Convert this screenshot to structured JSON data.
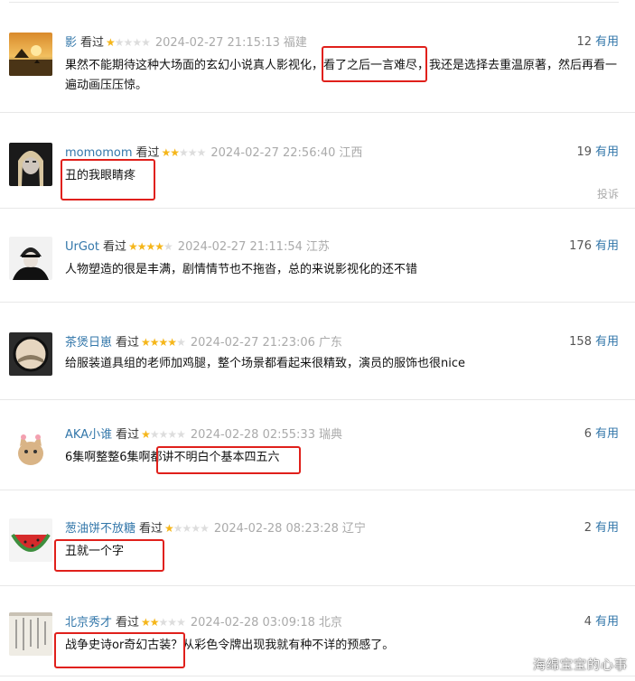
{
  "reviews": [
    {
      "user": "影",
      "status": "看过",
      "rating": 1,
      "time": "2024-02-27 21:15:13",
      "location": "福建",
      "votes": "12",
      "useful": "有用",
      "text": "果然不能期待这种大场面的玄幻小说真人影视化，看了之后一言难尽，我还是选择去重温原著，然后再看一遍动画压压惊。"
    },
    {
      "user": "momomom",
      "status": "看过",
      "rating": 2,
      "time": "2024-02-27 22:56:40",
      "location": "江西",
      "votes": "19",
      "useful": "有用",
      "text": "丑的我眼睛疼",
      "report": "投诉"
    },
    {
      "user": "UrGot",
      "status": "看过",
      "rating": 4,
      "time": "2024-02-27 21:11:54",
      "location": "江苏",
      "votes": "176",
      "useful": "有用",
      "text": "人物塑造的很是丰满，剧情情节也不拖沓，总的来说影视化的还不错"
    },
    {
      "user": "茶煲日崽",
      "status": "看过",
      "rating": 4,
      "time": "2024-02-27 21:23:06",
      "location": "广东",
      "votes": "158",
      "useful": "有用",
      "text": "给服装道具组的老师加鸡腿，整个场景都看起来很精致，演员的服饰也很nice"
    },
    {
      "user": "AKA小谁",
      "status": "看过",
      "rating": 1,
      "time": "2024-02-28 02:55:33",
      "location": "瑞典",
      "votes": "6",
      "useful": "有用",
      "text": "6集啊整整6集啊都讲不明白个基本四五六"
    },
    {
      "user": "葱油饼不放糖",
      "status": "看过",
      "rating": 1,
      "time": "2024-02-28 08:23:28",
      "location": "辽宁",
      "votes": "2",
      "useful": "有用",
      "text": "丑就一个字"
    },
    {
      "user": "北京秀才",
      "status": "看过",
      "rating": 2,
      "time": "2024-02-28 03:09:18",
      "location": "北京",
      "votes": "4",
      "useful": "有用",
      "text": "战争史诗or奇幻古装？从彩色令牌出现我就有种不详的预感了。"
    }
  ],
  "watermark": "海绵宝宝的心事",
  "colors": {
    "star": "#f5b61a",
    "link": "#3377aa",
    "highlight": "#e0201b"
  }
}
